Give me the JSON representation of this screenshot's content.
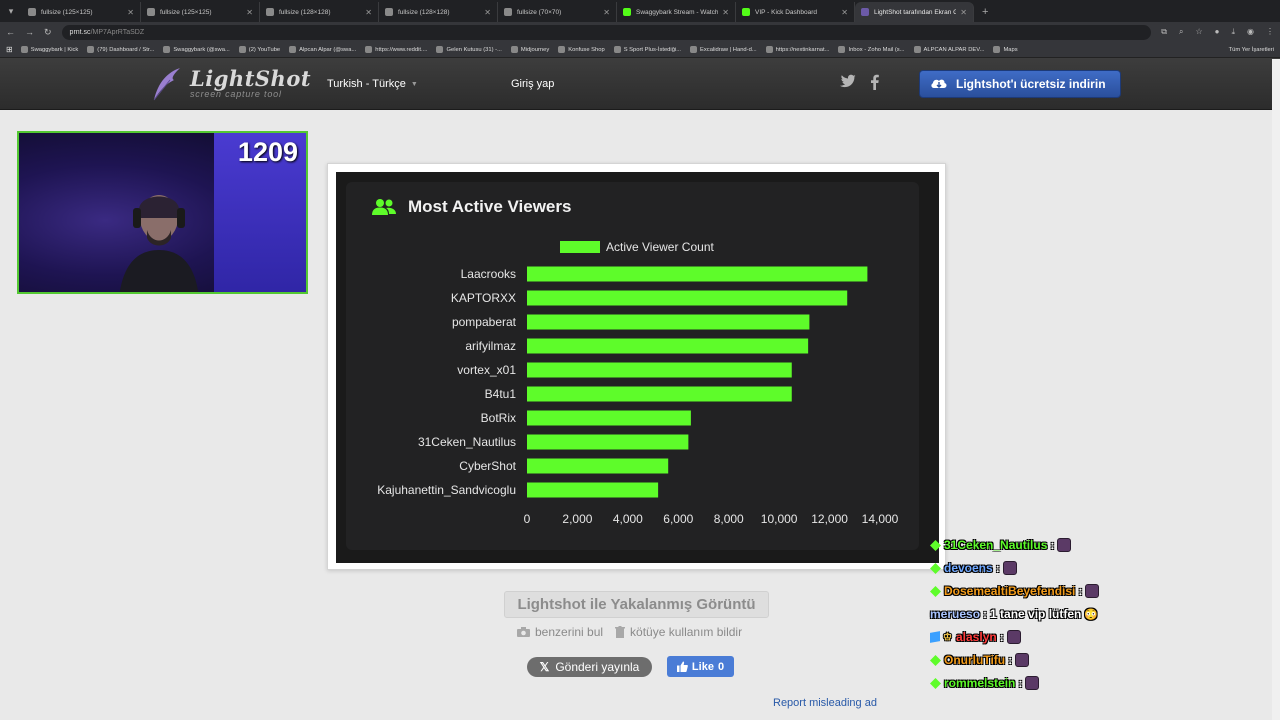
{
  "browser": {
    "tabs": [
      {
        "title": "fullsize (125×125)",
        "fav": "page"
      },
      {
        "title": "fullsize (125×125)",
        "fav": "page"
      },
      {
        "title": "fullsize (128×128)",
        "fav": "page"
      },
      {
        "title": "fullsize (128×128)",
        "fav": "page"
      },
      {
        "title": "fullsize (70×70)",
        "fav": "page"
      },
      {
        "title": "Swaggybark Stream - Watch Liv",
        "fav": "kick"
      },
      {
        "title": "VIP - Kick Dashboard",
        "fav": "kick"
      },
      {
        "title": "LightShot tarafından Ekran Gör",
        "fav": "ls"
      }
    ],
    "url_host": "prnt.sc",
    "url_path": "/MP7AprRTaSDZ",
    "bookmarks": [
      "Swaggybark | Kick",
      "(79) Dashboard / Str...",
      "Swaggybark (@swa...",
      "(2) YouTube",
      "Alpcan Alpar (@swa...",
      "https://www.reddit....",
      "Gelen Kutusu (31) -...",
      "Midjourney",
      "Konfuse Shop",
      "S Sport Plus-İstediği...",
      "Excalidraw | Hand-d...",
      "https://nextinkarnat...",
      "Inbox - Zoho Mail (s...",
      "ALPCAN ALPAR DEV...",
      "Maps"
    ],
    "bookmarks_all": "Tüm Yer İşaretleri"
  },
  "header": {
    "logo_title": "LightShot",
    "logo_subtitle": "screen capture tool",
    "language": "Turkish - Türkçe",
    "login": "Giriş yap",
    "download": "Lightshot'ı ücretsiz indirin"
  },
  "webcam": {
    "viewer_count": "1209"
  },
  "screenshot": {
    "title": "Most Active Viewers"
  },
  "chart_data": {
    "type": "bar",
    "orientation": "horizontal",
    "title": "Most Active Viewers",
    "categories": [
      "Laacrooks",
      "KAPTORXX",
      "pompaberat",
      "arifyilmaz",
      "vortex_x01",
      "B4tu1",
      "BotRix",
      "31Ceken_Nautilus",
      "CyberShot",
      "Kajuhanettin_Sandvicoglu"
    ],
    "series": [
      {
        "name": "Active Viewer Count",
        "values": [
          13500,
          12700,
          11200,
          11150,
          10500,
          10500,
          6500,
          6400,
          5600,
          5200
        ],
        "color": "#5efc2a"
      }
    ],
    "xlim": [
      0,
      14000
    ],
    "xticks": [
      "0",
      "2,000",
      "4,000",
      "6,000",
      "8,000",
      "10,000",
      "12,000",
      "14,000"
    ],
    "legend_position": "top",
    "grid": false
  },
  "info": {
    "caption": "Lightshot ile Yakalanmış Görüntü",
    "find_similar": "benzerini bul",
    "report_abuse": "kötüye kullanım bildir",
    "tweet": "Gönderi yayınla",
    "like": "Like",
    "like_count": "0",
    "report_ad": "Report misleading ad"
  },
  "chat": [
    {
      "user": "31Ceken_Nautilus",
      "color": "#5efc2a",
      "badge": "diamond",
      "message": ""
    },
    {
      "user": "devoens",
      "color": "#6fa8ff",
      "badge": "diamond",
      "message": ""
    },
    {
      "user": "DosemealtiBeyefendisi",
      "color": "#f29b1a",
      "badge": "diamond",
      "message": ""
    },
    {
      "user": "merueso",
      "color": "#a9c4ff",
      "badge": "",
      "message": "1 tane vip lütfen"
    },
    {
      "user": "alaslyn",
      "color": "#ff3b3b",
      "badge": "cube-vip",
      "message": ""
    },
    {
      "user": "OnurluTifu",
      "color": "#f29b1a",
      "badge": "diamond",
      "message": ""
    },
    {
      "user": "rommelstein",
      "color": "#5efc2a",
      "badge": "diamond",
      "message": ""
    }
  ]
}
